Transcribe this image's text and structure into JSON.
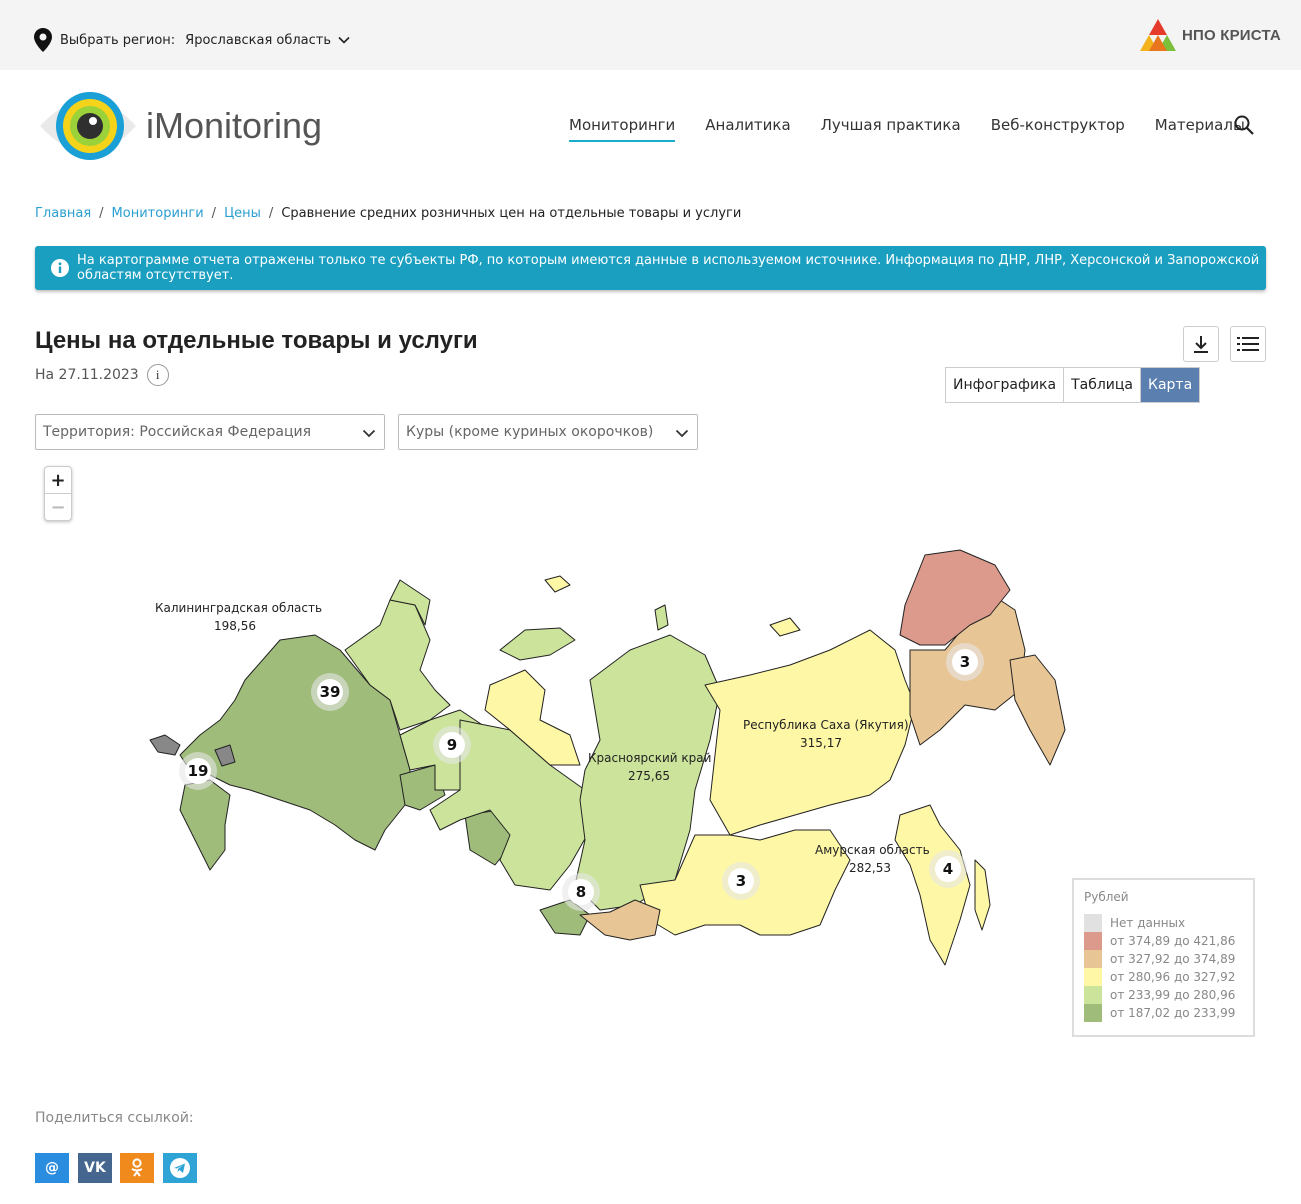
{
  "topbar": {
    "region_label": "Выбрать регион:",
    "region_value": "Ярославская область",
    "partner_logo_text": "НПО КРИСТА"
  },
  "header": {
    "brand": "iMonitoring",
    "nav": [
      "Мониторинги",
      "Аналитика",
      "Лучшая практика",
      "Веб-конструктор",
      "Материалы"
    ],
    "active_nav": "Мониторинги"
  },
  "breadcrumb": [
    "Главная",
    "Мониторинги",
    "Цены",
    "Сравнение средних розничных цен на отдельные товары и услуги"
  ],
  "alert": {
    "text": "На картограмме отчета отражены только те субъекты РФ, по которым имеются данные в используемом источнике. Информация по ДНР,  ЛНР,  Херсонской и Запорожской областям отсутствует."
  },
  "report": {
    "title": "Цены на отдельные товары и услуги",
    "date": "На 27.11.2023",
    "views": [
      "Инфографика",
      "Таблица",
      "Карта"
    ],
    "active_view": "Карта"
  },
  "filters": {
    "territory": "Территория: Российская  Федерация",
    "product": "Куры (кроме куриных окорочков)"
  },
  "zoom": {
    "plus": "+",
    "minus": "−"
  },
  "map": {
    "region_labels": [
      {
        "name": "Калининградская область",
        "value": "198,56"
      },
      {
        "name": "Республика Саха (Якутия)",
        "value": "315,17"
      },
      {
        "name": "Красноярский край",
        "value": "275,65"
      },
      {
        "name": "Амурская область",
        "value": "282,53"
      }
    ],
    "clusters": [
      "39",
      "9",
      "19",
      "8",
      "3",
      "3",
      "4"
    ]
  },
  "legend": {
    "title": "Рублей",
    "items": [
      {
        "label": "Нет данных",
        "color": "#e1e1e1"
      },
      {
        "label": "от 374,89 до 421,86",
        "color": "#dc9a8c"
      },
      {
        "label": "от 327,92 до 374,89",
        "color": "#e8c595"
      },
      {
        "label": "от 280,96 до 327,92",
        "color": "#fdf7a6"
      },
      {
        "label": "от 233,99 до 280,96",
        "color": "#cbe39a"
      },
      {
        "label": "от 187,02 до 233,99",
        "color": "#9fbc7b"
      }
    ]
  },
  "share": {
    "label": "Поделиться ссылкой:",
    "buttons": [
      {
        "icon": "mail-icon",
        "text": "@",
        "color": "#2a8de0"
      },
      {
        "icon": "vk-icon",
        "text": "VK",
        "color": "#45668e"
      },
      {
        "icon": "ok-icon",
        "text": "OK",
        "color": "#f08a1c"
      },
      {
        "icon": "telegram-icon",
        "text": "",
        "color": "#2ea3d6"
      }
    ]
  }
}
